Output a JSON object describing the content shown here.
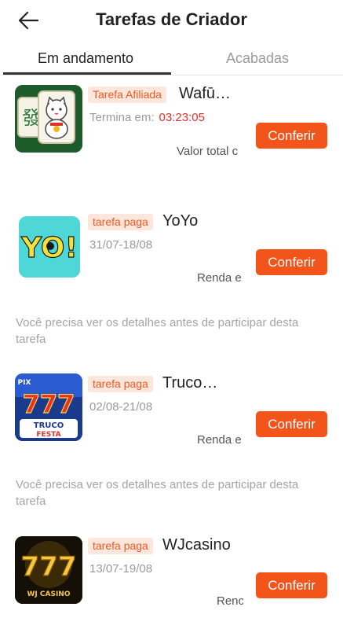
{
  "header": {
    "title": "Tarefas de Criador",
    "back_icon": "arrow-left-icon"
  },
  "tabs": [
    {
      "label": "Em andamento",
      "active": true
    },
    {
      "label": "Acabadas",
      "active": false
    }
  ],
  "tasks": [
    {
      "badge": "Tarefa Afiliada",
      "name": "Wafū…",
      "ends_label": "Termina em",
      "colon": ":",
      "countdown": "03:23:05",
      "reward_label": "Valor total c",
      "button": "Conferir",
      "thumb_icon": "mahjong-lucky-cat-icon"
    },
    {
      "badge": "tarefa paga",
      "name": "YoYo",
      "dates": "31/07-18/08",
      "reward_label": "Renda e",
      "button": "Conferir",
      "thumb_text": "YO!",
      "notice": "Você precisa ver os detalhes antes de participar desta tarefa"
    },
    {
      "badge": "tarefa paga",
      "name": "Truco…",
      "dates": "02/08-21/08",
      "reward_label": "Renda e",
      "button": "Conferir",
      "thumb_text_top": "PIX",
      "thumb_text_mid": "777",
      "thumb_text_1": "TRUCO",
      "thumb_text_2": "FESTA",
      "notice": "Você precisa ver os detalhes antes de participar desta tarefa"
    },
    {
      "badge": "tarefa paga",
      "name": "WJcasino",
      "dates": "13/07-19/08",
      "reward_label": "Renc",
      "button": "Conferir",
      "thumb_text_mid": "777",
      "thumb_text_1": "WJ CASINO"
    }
  ],
  "colors": {
    "accent": "#f2541a",
    "badge_bg": "#fde6dc",
    "badge_text": "#ef5a22",
    "countdown": "#e0322b"
  }
}
